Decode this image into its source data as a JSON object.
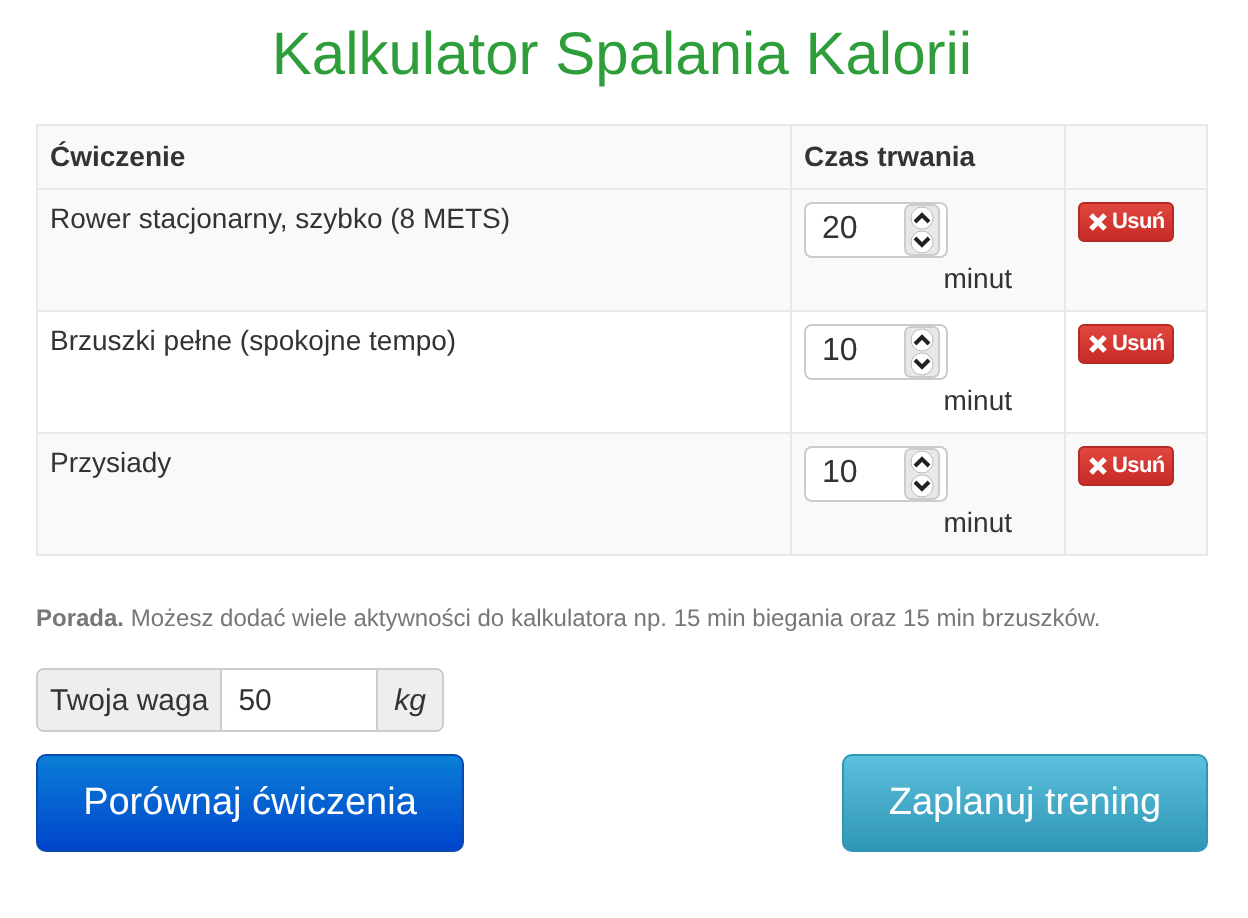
{
  "title": "Kalkulator Spalania Kalorii",
  "table": {
    "columns": [
      "Ćwiczenie",
      "Czas trwania"
    ],
    "rows": [
      {
        "exercise": "Rower stacjonarny, szybko (8 METS)",
        "duration": "20",
        "unit": "minut",
        "remove": "Usuń"
      },
      {
        "exercise": "Brzuszki pełne (spokojne tempo)",
        "duration": "10",
        "unit": "minut",
        "remove": "Usuń"
      },
      {
        "exercise": "Przysiady",
        "duration": "10",
        "unit": "minut",
        "remove": "Usuń"
      }
    ]
  },
  "tip": "**Porada.** Możesz dodać wiele aktywności do kalkulatora np. 15 min biegania oraz 15 min brzuszków.",
  "weight": {
    "label": "Twoja waga",
    "value": "50",
    "unit": "kg"
  },
  "buttons": [
    "Porównaj ćwiczenia",
    "Zaplanuj trening"
  ]
}
